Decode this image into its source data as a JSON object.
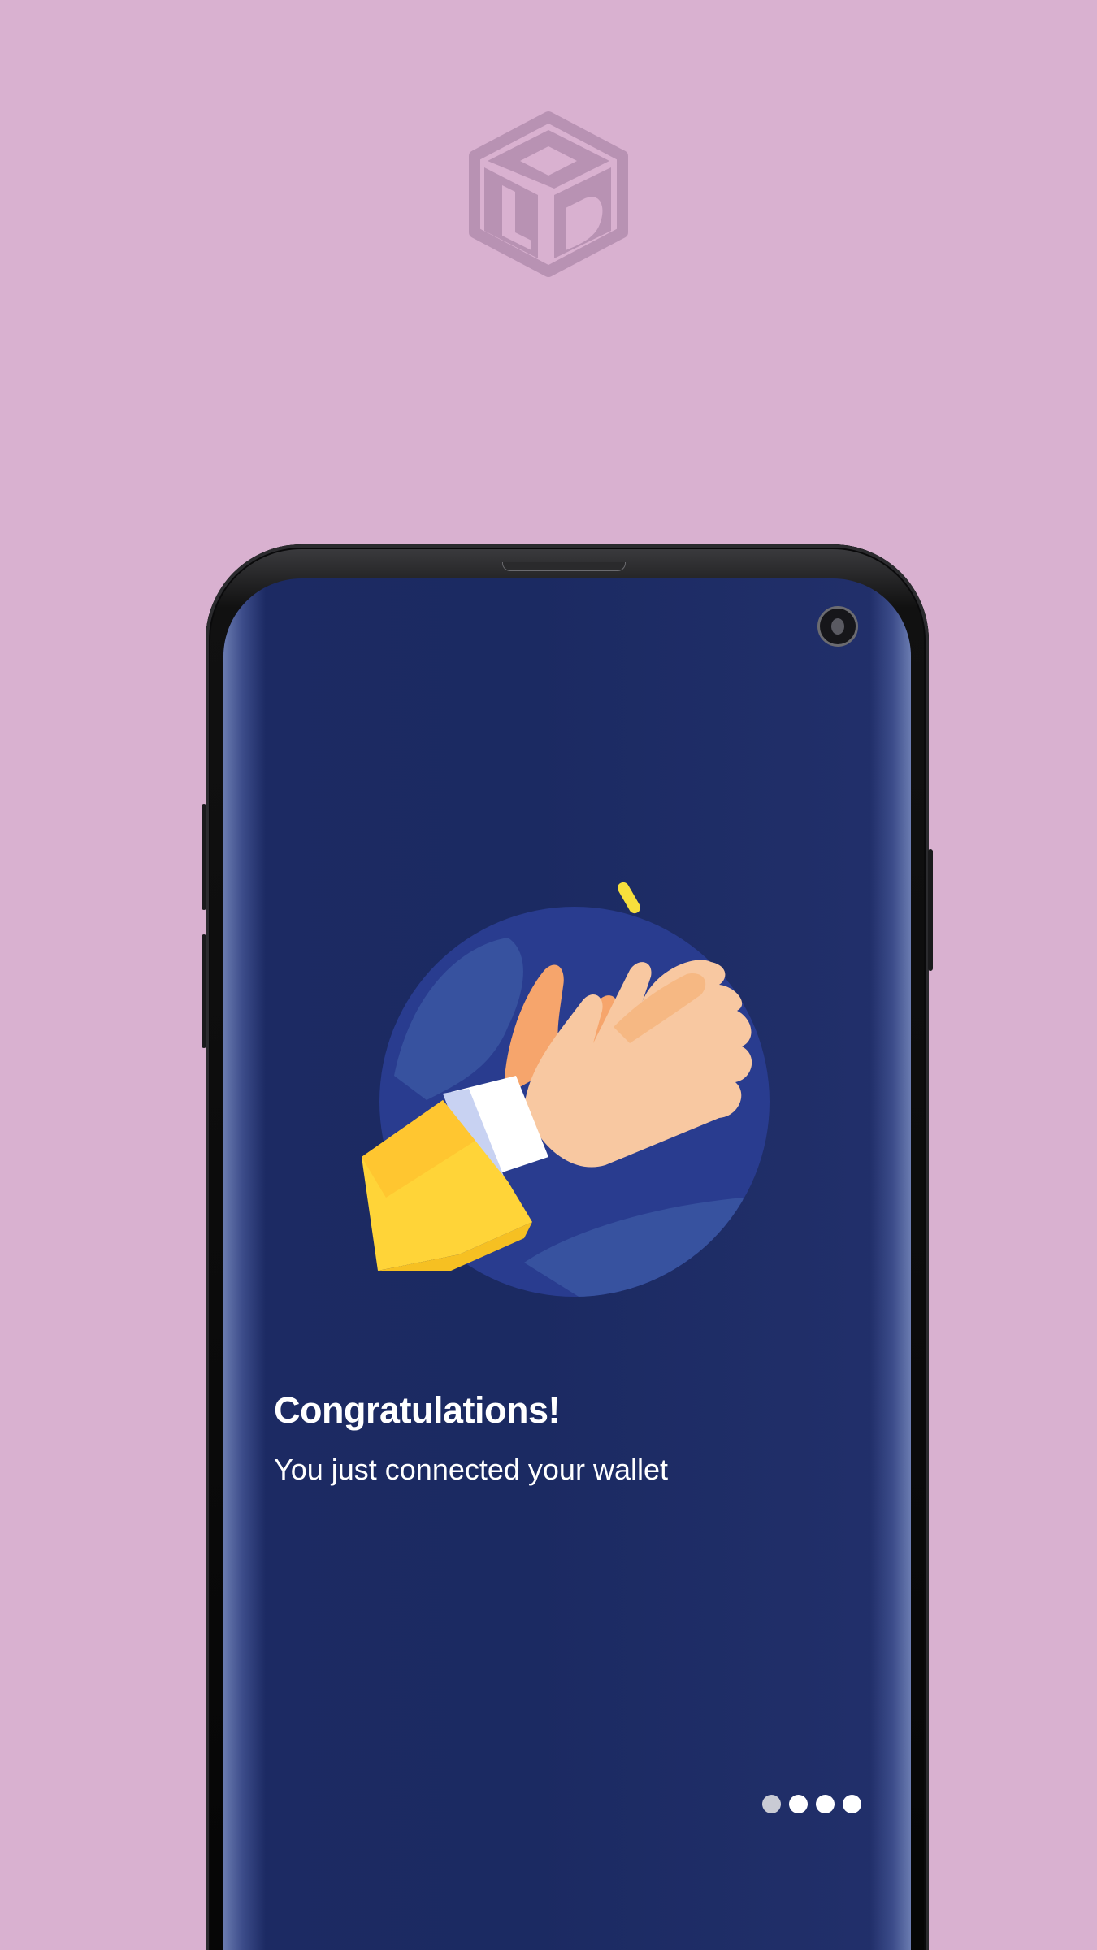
{
  "brand": {
    "logo_icon": "cube-logo-icon",
    "logo_color": "#b892b3"
  },
  "background_color": "#d9b1d0",
  "screen": {
    "background_color": "#1c2a63",
    "illustration_icon": "clapping-hands-icon",
    "title": "Congratulations!",
    "subtitle": "You just connected your wallet",
    "pager": {
      "total": 4,
      "current": 1
    }
  }
}
